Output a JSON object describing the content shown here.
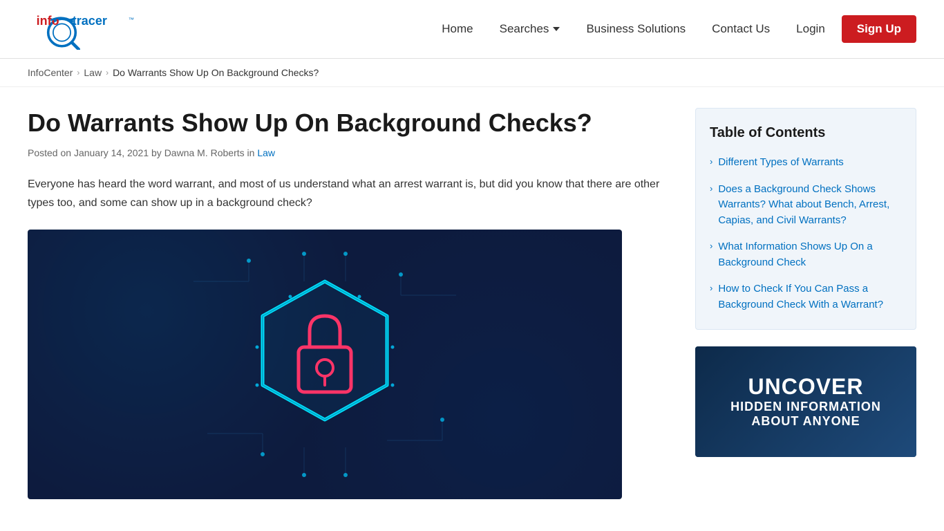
{
  "header": {
    "logo_alt": "InfoTracer",
    "nav": {
      "home": "Home",
      "searches": "Searches",
      "business_solutions": "Business Solutions",
      "contact_us": "Contact Us",
      "login": "Login",
      "signup": "Sign Up"
    }
  },
  "breadcrumb": {
    "infocenter": "InfoCenter",
    "law": "Law",
    "current": "Do Warrants Show Up On Background Checks?"
  },
  "article": {
    "title": "Do Warrants Show Up On Background Checks?",
    "meta": "Posted on January 14, 2021 by Dawna M. Roberts in",
    "meta_link": "Law",
    "intro": "Everyone has heard the word warrant, and most of us understand what an arrest warrant is, but did you know that there are other types too, and some can show up in a background check?"
  },
  "toc": {
    "title": "Table of Contents",
    "items": [
      {
        "label": "Different Types of Warrants",
        "href": "#"
      },
      {
        "label": "Does a Background Check Shows Warrants? What about Bench, Arrest, Capias, and Civil Warrants?",
        "href": "#"
      },
      {
        "label": "What Information Shows Up On a Background Check",
        "href": "#"
      },
      {
        "label": "How to Check If You Can Pass a Background Check With a Warrant?",
        "href": "#"
      }
    ]
  },
  "promo": {
    "line1": "UNCOVER",
    "line2": "HIDDEN INFORMATION",
    "line3": "ABOUT ANYONE"
  }
}
